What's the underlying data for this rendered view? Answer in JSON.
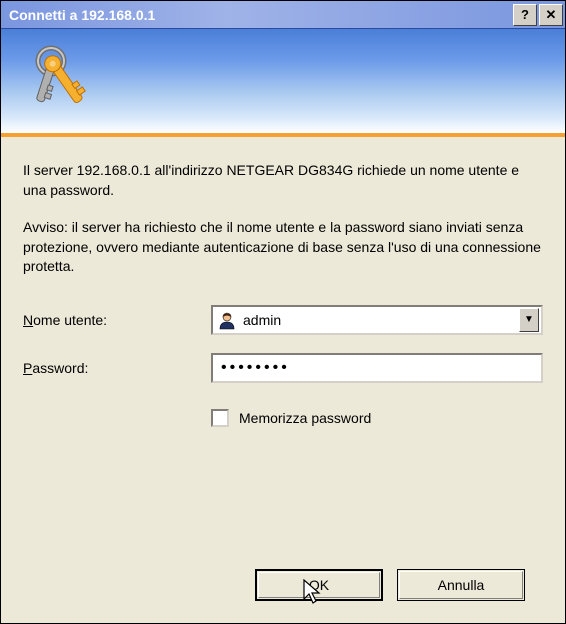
{
  "titlebar": {
    "title": "Connetti a 192.168.0.1"
  },
  "message": "Il server 192.168.0.1 all'indirizzo NETGEAR DG834G  richiede un nome utente e una password.",
  "warning": "Avviso: il server ha richiesto che il nome utente e la password siano inviati senza protezione, ovvero mediante autenticazione di base senza l'uso di una connessione protetta.",
  "form": {
    "username_label_pre": "N",
    "username_label_post": "ome utente:",
    "username_value": "admin",
    "password_label_pre": "P",
    "password_label_post": "assword:",
    "password_value": "••••••••",
    "remember_label": "Memorizza password"
  },
  "buttons": {
    "ok": "OK",
    "cancel": "Annulla"
  }
}
